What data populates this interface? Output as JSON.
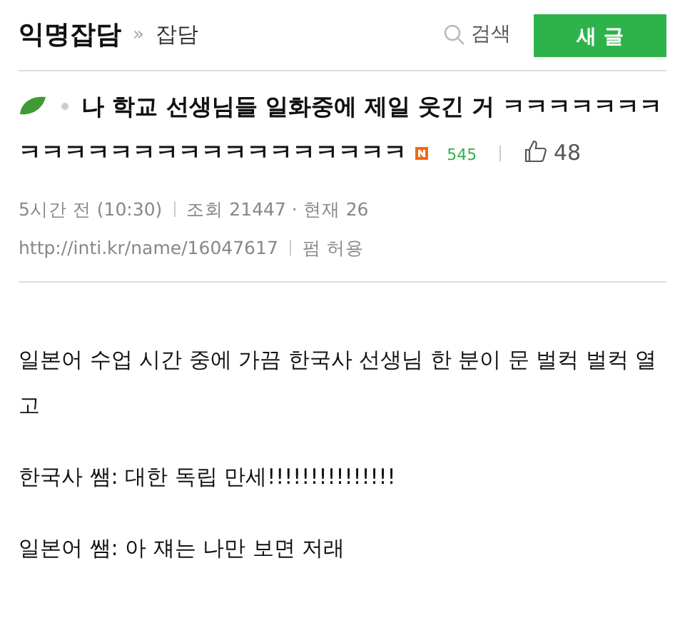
{
  "header": {
    "board": "익명잡담",
    "separator": "»",
    "category": "잡담",
    "search": "검색",
    "new_post_button": "새 글"
  },
  "post": {
    "title_lines": [
      "나 학교 선생님들 일화중에 제일 웃긴 거 ㅋㅋㅋㅋㅋㅋㅋ",
      "ㅋㅋㅋㅋㅋㅋㅋㅋㅋㅋㅋㅋㅋㅋㅋㅋㅋ"
    ],
    "comment_count": "545",
    "likes": "48",
    "time": "5시간 전 (10:30)",
    "views": "조회 21447 · 현재 26",
    "url": "http://inti.kr/name/16047617",
    "share": "펌 허용",
    "paragraphs": [
      "일본어 수업 시간 중에 가끔 한국사 선생님 한 분이 문 벌컥 벌컥 열고",
      "한국사 쌤: 대한 독립 만세!!!!!!!!!!!!!!!",
      "일본어 쌤: 아 쟤는 나만 보면 저래"
    ]
  }
}
